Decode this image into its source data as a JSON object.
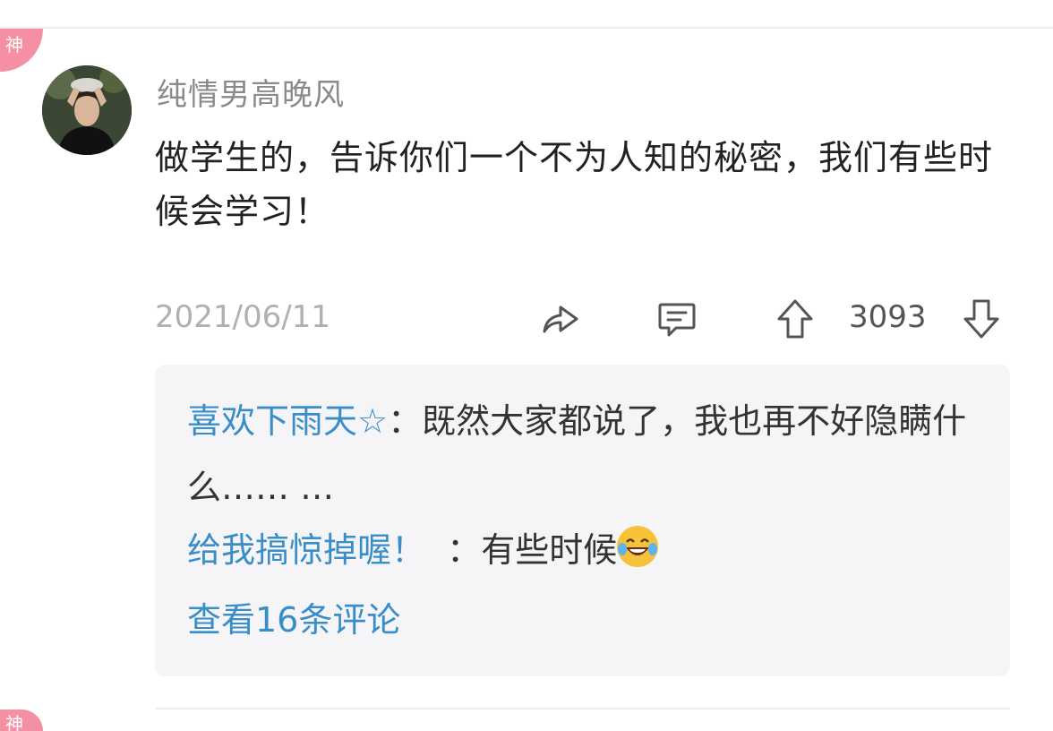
{
  "badge": {
    "label": "神"
  },
  "post": {
    "username": "纯情男高晚风",
    "text": "做学生的，告诉你们一个不为人知的秘密，我们有些时候会学习！",
    "date": "2021/06/11",
    "upvote_count": "3093"
  },
  "replies": [
    {
      "name": "喜欢下雨天☆",
      "separator": "：",
      "text": "既然大家都说了，我也再不好隐瞒什么……         …"
    },
    {
      "name": "给我搞惊掉喔！",
      "separator": "  ：",
      "text": "有些时候",
      "emoji": "laugh-cry-emoji"
    }
  ],
  "view_all_label": "查看16条评论",
  "icons": {
    "share": "share-arrow-icon",
    "comment": "comment-bubble-icon",
    "upvote": "up-arrow-icon",
    "downvote": "down-arrow-icon"
  },
  "colors": {
    "badge": "#f48fa4",
    "link": "#3a8ec8",
    "muted": "#8a8a8a",
    "reply_bg": "#f5f5f8"
  }
}
